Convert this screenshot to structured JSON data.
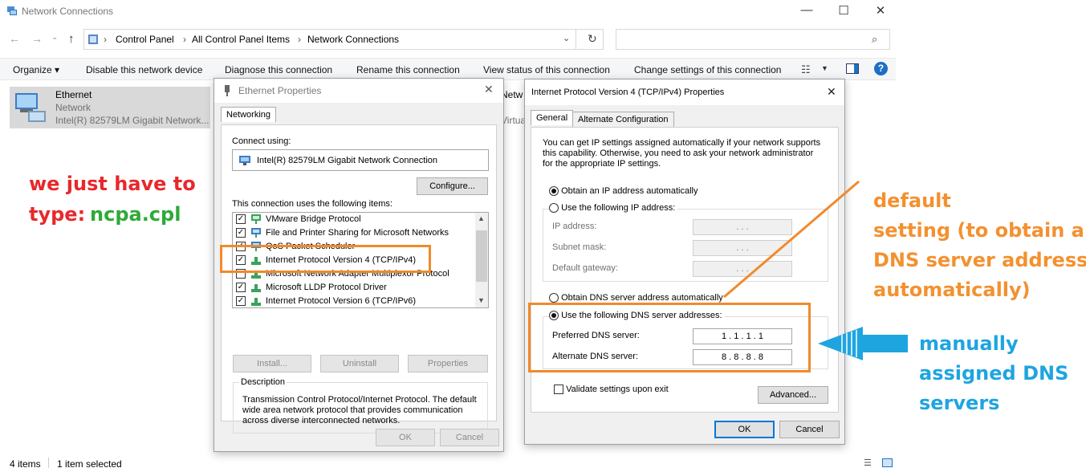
{
  "explorer": {
    "title": "Network Connections",
    "window_controls": [
      "—",
      "☐",
      "✕"
    ],
    "breadcrumb": [
      "Control Panel",
      "All Control Panel Items",
      "Network Connections"
    ],
    "search_placeholder": "",
    "commands": [
      "Organize ▾",
      "Disable this network device",
      "Diagnose this connection",
      "Rename this connection",
      "View status of this connection",
      "Change settings of this connection"
    ],
    "adapter": {
      "name": "Ethernet",
      "network": "Network",
      "device": "Intel(R) 82579LM Gigabit Network..."
    },
    "partial_adapter": {
      "line1": "Netw",
      "line2": "Virtua"
    },
    "status": {
      "items": "4 items",
      "selected": "1 item selected"
    }
  },
  "ethernet_dialog": {
    "title": "Ethernet Properties",
    "tab": "Networking",
    "connect_using_label": "Connect using:",
    "adapter_name": "Intel(R) 82579LM Gigabit Network Connection",
    "configure_button": "Configure...",
    "items_label": "This connection uses the following items:",
    "items": [
      {
        "label": "VMware Bridge Protocol",
        "checked": true
      },
      {
        "label": "File and Printer Sharing for Microsoft Networks",
        "checked": true
      },
      {
        "label": "QoS Packet Scheduler",
        "checked": true
      },
      {
        "label": "Internet Protocol Version 4 (TCP/IPv4)",
        "checked": true
      },
      {
        "label": "Microsoft Network Adapter Multiplexor Protocol",
        "checked": false
      },
      {
        "label": "Microsoft LLDP Protocol Driver",
        "checked": true
      },
      {
        "label": "Internet Protocol Version 6 (TCP/IPv6)",
        "checked": true
      }
    ],
    "install_button": "Install...",
    "uninstall_button": "Uninstall",
    "properties_button": "Properties",
    "description_label": "Description",
    "description_text": "Transmission Control Protocol/Internet Protocol. The default wide area network protocol that provides communication across diverse interconnected networks.",
    "ok_button": "OK",
    "cancel_button": "Cancel"
  },
  "ipv4_dialog": {
    "title": "Internet Protocol Version 4 (TCP/IPv4) Properties",
    "tab_general": "General",
    "tab_alternate": "Alternate Configuration",
    "intro": "You can get IP settings assigned automatically if your network supports this capability. Otherwise, you need to ask your network administrator for the appropriate IP settings.",
    "obtain_ip_auto": "Obtain an IP address automatically",
    "use_following_ip": "Use the following IP address:",
    "ip_address_label": "IP address:",
    "subnet_label": "Subnet mask:",
    "gateway_label": "Default gateway:",
    "empty_ip": ". . .",
    "obtain_dns_auto": "Obtain DNS server address automatically",
    "use_following_dns": "Use the following DNS server addresses:",
    "preferred_dns_label": "Preferred DNS server:",
    "preferred_dns_value": "1 . 1 . 1 . 1",
    "alternate_dns_label": "Alternate DNS server:",
    "alternate_dns_value": "8 . 8 . 8 . 8",
    "validate_label": "Validate settings upon exit",
    "advanced_button": "Advanced...",
    "ok_button": "OK",
    "cancel_button": "Cancel"
  },
  "annotations": {
    "red_line1": "we just have to",
    "red_line2": "type:",
    "green_cmd": "ncpa.cpl",
    "orange_lines": [
      "default",
      "setting (to obtain a",
      "DNS server address",
      "automatically)"
    ],
    "blue_lines": [
      "manually",
      "assigned DNS",
      "servers"
    ]
  },
  "colors": {
    "annotation_red": "#e8282b",
    "annotation_green": "#2eaa38",
    "annotation_orange": "#f39130",
    "annotation_blue": "#1ea5e0",
    "highlight_box": "#f08a2c"
  }
}
